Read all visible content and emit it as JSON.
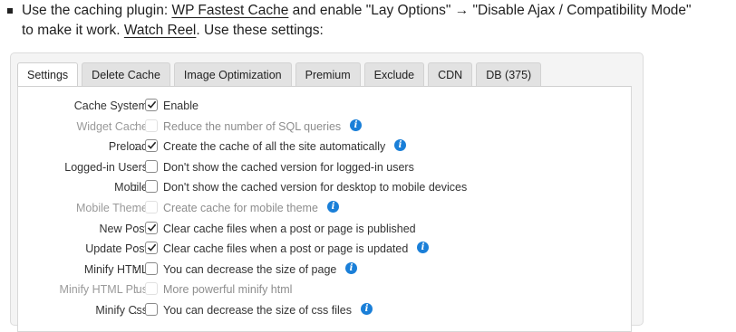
{
  "intro": {
    "line1_pre": "Use the caching plugin: ",
    "plugin_link": "WP Fastest Cache",
    "line1_post": " and enable \"Lay Options\" → \"Disable Ajax / Compatibility Mode\"",
    "line2_pre": "to make it work. ",
    "reel_link": "Watch Reel",
    "line2_post": ". Use these settings:"
  },
  "tabs": [
    {
      "label": "Settings",
      "active": true
    },
    {
      "label": "Delete Cache"
    },
    {
      "label": "Image Optimization"
    },
    {
      "label": "Premium"
    },
    {
      "label": "Exclude"
    },
    {
      "label": "CDN"
    },
    {
      "label": "DB (375)"
    }
  ],
  "settings": [
    {
      "label": "Cache System",
      "colon": ":",
      "desc": "Enable",
      "checked": true,
      "disabled": false,
      "info": false
    },
    {
      "label": "Widget Cache",
      "colon": ":",
      "desc": "Reduce the number of SQL queries",
      "checked": false,
      "disabled": true,
      "info": true
    },
    {
      "label": "Preload",
      "colon": ":",
      "desc": "Create the cache of all the site automatically",
      "checked": true,
      "disabled": false,
      "info": true
    },
    {
      "label": "Logged-in Users",
      "colon": ":",
      "desc": "Don't show the cached version for logged-in users",
      "checked": false,
      "disabled": false,
      "info": false
    },
    {
      "label": "Mobile",
      "colon": ":",
      "desc": "Don't show the cached version for desktop to mobile devices",
      "checked": false,
      "disabled": false,
      "info": false
    },
    {
      "label": "Mobile Theme",
      "colon": ":",
      "desc": "Create cache for mobile theme",
      "checked": false,
      "disabled": true,
      "info": true
    },
    {
      "label": "New Post",
      "colon": ":",
      "desc": "Clear cache files when a post or page is published",
      "checked": true,
      "disabled": false,
      "info": false
    },
    {
      "label": "Update Post",
      "colon": ":",
      "desc": "Clear cache files when a post or page is updated",
      "checked": true,
      "disabled": false,
      "info": true
    },
    {
      "label": "Minify HTML",
      "colon": ":",
      "desc": "You can decrease the size of page",
      "checked": false,
      "disabled": false,
      "info": true
    },
    {
      "label": "Minify HTML Plus",
      "colon": ":",
      "desc": "More powerful minify html",
      "checked": false,
      "disabled": true,
      "info": false
    },
    {
      "label": "Minify Css",
      "colon": ":",
      "desc": "You can decrease the size of css files",
      "checked": false,
      "disabled": false,
      "info": true
    }
  ],
  "colors": {
    "info_icon": "#1a7fd8"
  }
}
